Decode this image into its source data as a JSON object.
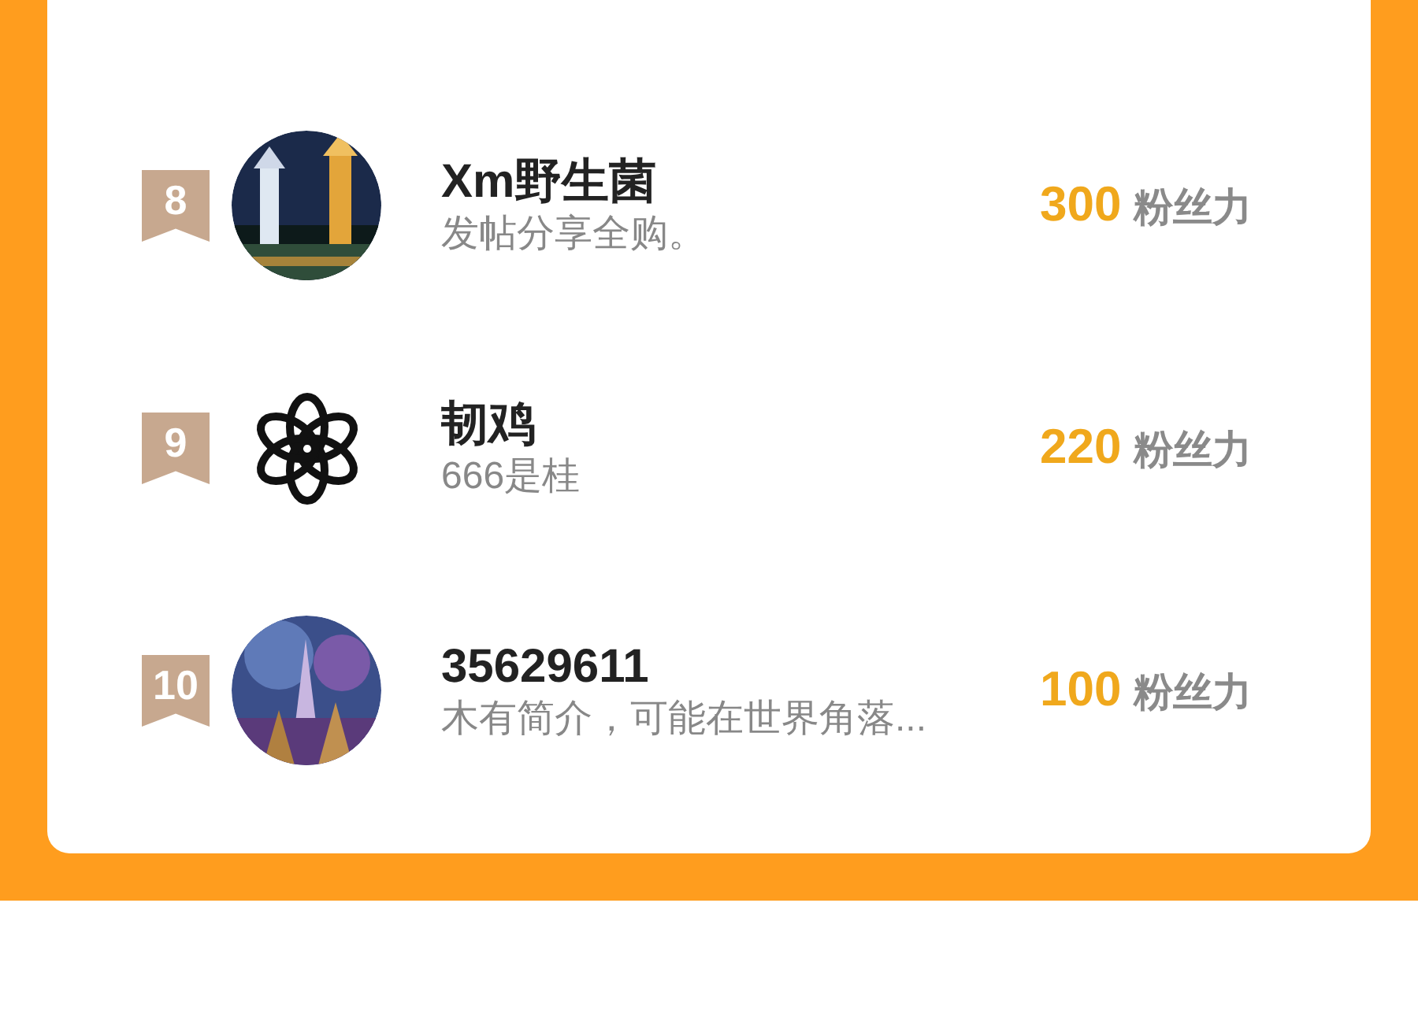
{
  "ranking": [
    {
      "rank": "8",
      "name": "Xm野生菌",
      "bio": "发帖分享全购。",
      "score": "300",
      "unit": "粉丝力",
      "kind": "picture"
    },
    {
      "rank": "9",
      "name": "韧鸡",
      "bio": "666是桂",
      "score": "220",
      "unit": "粉丝力",
      "kind": "icon"
    },
    {
      "rank": "10",
      "name": "35629611",
      "bio": "木有简介，可能在世界角落...",
      "score": "100",
      "unit": "粉丝力",
      "kind": "picture"
    }
  ]
}
